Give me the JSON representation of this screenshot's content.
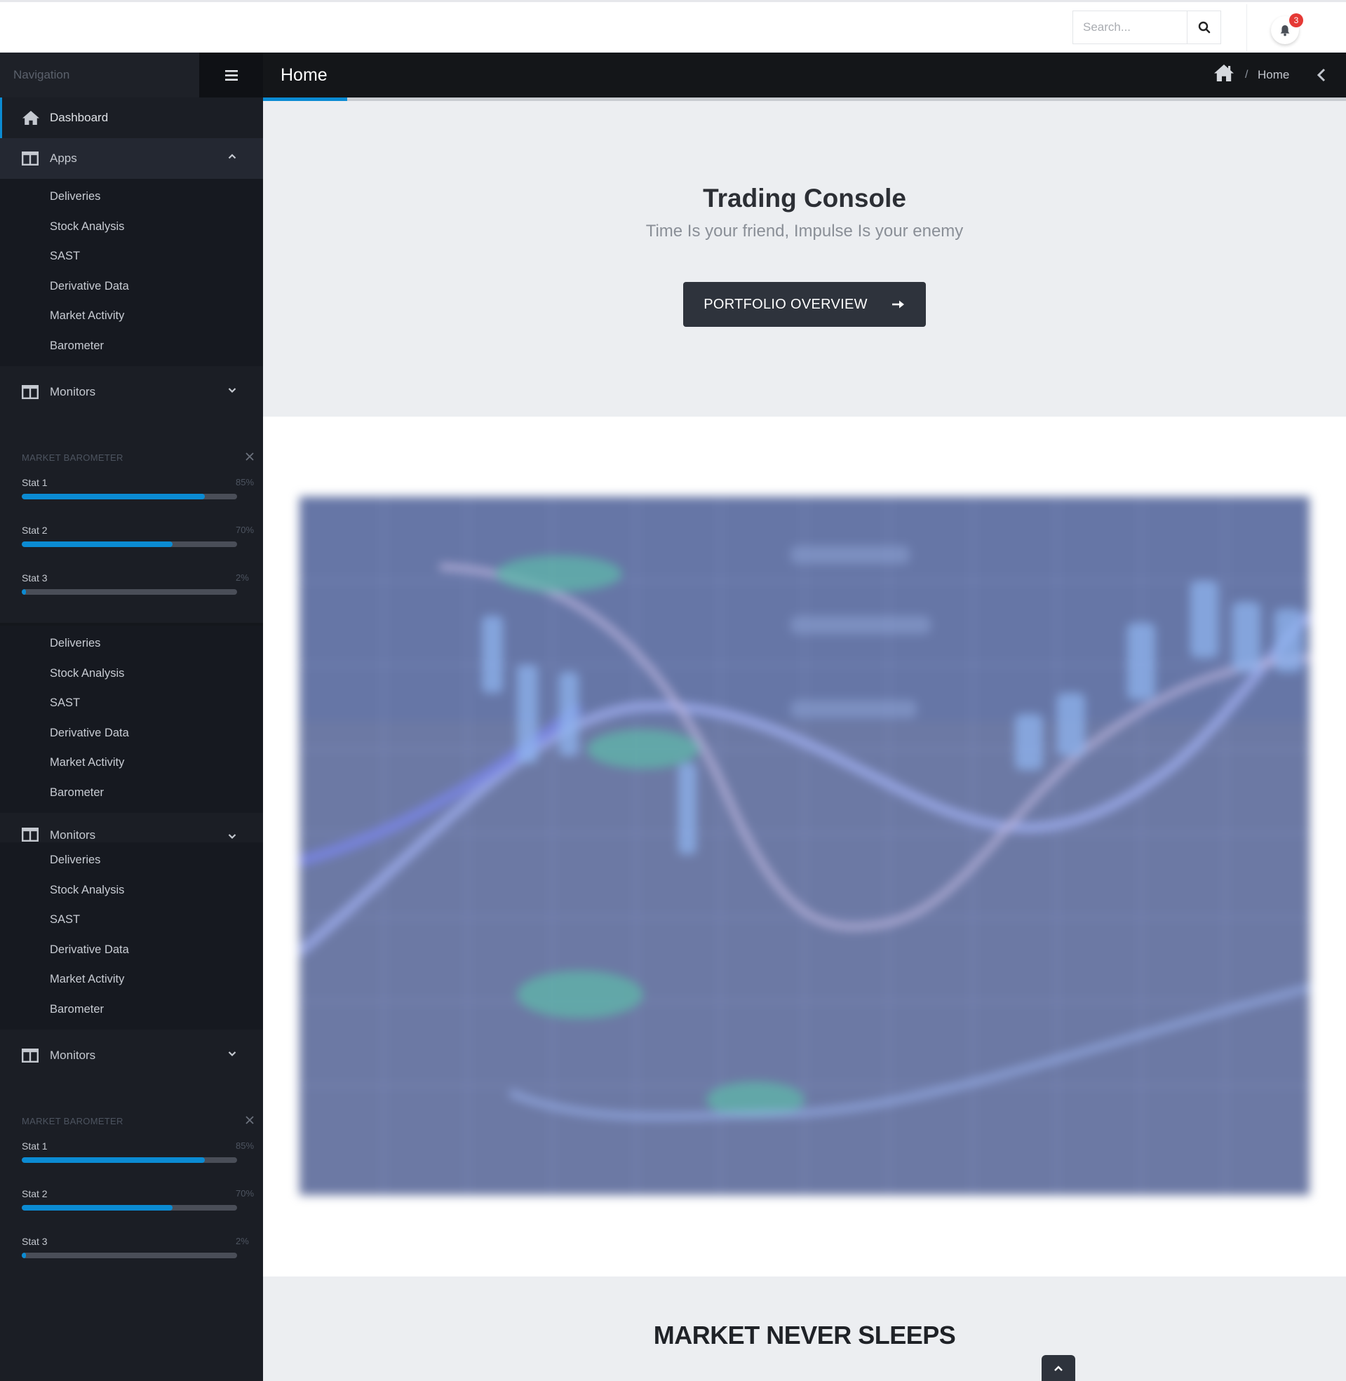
{
  "topbar": {
    "search_placeholder": "Search...",
    "notification_count": "3"
  },
  "sidebar": {
    "nav_title": "Navigation",
    "dashboard_label": "Dashboard",
    "apps_label": "Apps",
    "monitors_label": "Monitors",
    "submenu": [
      "Deliveries",
      "Stock Analysis",
      "SAST",
      "Derivative Data",
      "Market Activity",
      "Barometer"
    ],
    "widget_title": "MARKET BAROMETER",
    "stats": [
      {
        "label": "Stat 1",
        "pct": "85%",
        "value": 85
      },
      {
        "label": "Stat 2",
        "pct": "70%",
        "value": 70
      },
      {
        "label": "Stat 3",
        "pct": "2%",
        "value": 2
      }
    ]
  },
  "header": {
    "title": "Home",
    "breadcrumb_separator": "/",
    "breadcrumb_current": "Home"
  },
  "hero": {
    "title": "Trading Console",
    "subtitle": "Time Is your friend, Impulse Is your enemy",
    "button_label": "PORTFOLIO OVERVIEW"
  },
  "section2": {
    "title": "MARKET NEVER SLEEPS"
  },
  "colors": {
    "accent": "#0b8bd3",
    "sidebar_bg": "#1b1e25",
    "header_bg": "#141619",
    "hero_bg": "#eceef1",
    "button_bg": "#2e333c",
    "badge": "#e53935"
  },
  "icons": [
    "search-icon",
    "bell-icon",
    "hamburger-icon",
    "home-icon",
    "grid-icon",
    "chevron-up-icon",
    "chevron-down-icon",
    "close-icon",
    "chevron-left-icon",
    "arrow-right-icon"
  ]
}
